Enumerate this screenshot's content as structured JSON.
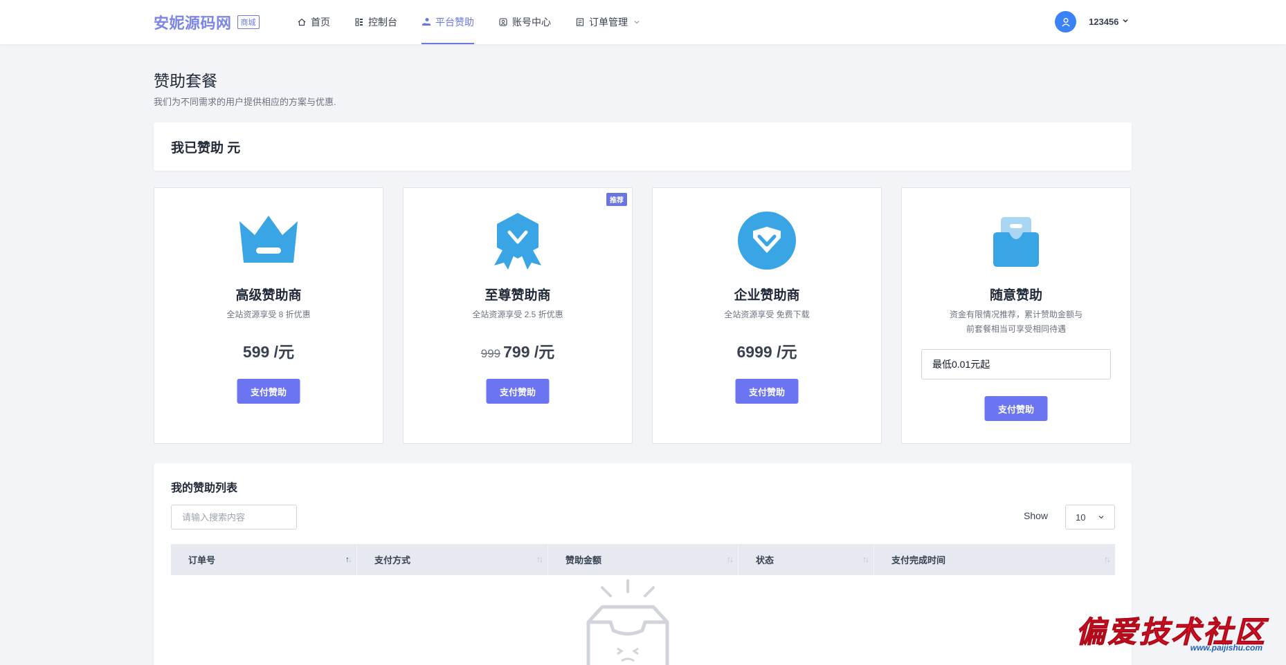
{
  "header": {
    "brand": "安妮源码网",
    "brand_tag": "商城",
    "nav": [
      {
        "label": "首页",
        "icon": "home-icon"
      },
      {
        "label": "控制台",
        "icon": "dashboard-icon"
      },
      {
        "label": "平台赞助",
        "icon": "hand-coin-icon",
        "active": true
      },
      {
        "label": "账号中心",
        "icon": "account-icon"
      },
      {
        "label": "订单管理",
        "icon": "order-icon",
        "dropdown": true
      }
    ],
    "user": {
      "name": "123456",
      "avatar_icon": "user-icon"
    }
  },
  "page": {
    "title": "赞助套餐",
    "subtitle": "我们为不同需求的用户提供相应的方案与优惠."
  },
  "sponsored_summary": "我已赞助 元",
  "plans": [
    {
      "name": "高级赞助商",
      "desc": "全站资源享受 8 折优惠",
      "price": "599 /元",
      "button": "支付赞助",
      "icon": "crown-icon"
    },
    {
      "name": "至尊赞助商",
      "desc": "全站资源享受 2.5 折优惠",
      "old_price": "999",
      "price": "799 /元",
      "button": "支付赞助",
      "badge": "推荐",
      "icon": "medal-icon"
    },
    {
      "name": "企业赞助商",
      "desc": "全站资源享受 免费下载",
      "price": "6999 /元",
      "button": "支付赞助",
      "icon": "diamond-icon"
    },
    {
      "name": "随意赞助",
      "desc_lines": [
        "资金有限情况推荐，累计赞助金额与",
        "前套餐相当可享受相同待遇"
      ],
      "input_value": "最低0.01元起",
      "button": "支付赞助",
      "icon": "wallet-icon"
    }
  ],
  "list": {
    "title": "我的赞助列表",
    "search_placeholder": "请输入搜索内容",
    "show_label": "Show",
    "page_size": "10",
    "columns": [
      "订单号",
      "支付方式",
      "赞助金额",
      "状态",
      "支付完成时间"
    ],
    "rows": []
  },
  "watermark": {
    "text": "偏爱技术社区",
    "url": "www.paijishu.com"
  },
  "colors": {
    "accent": "#6b75e0",
    "button": "#6b75f2",
    "icon_blue": "#3aa5e4",
    "avatar": "#3b82f6"
  }
}
